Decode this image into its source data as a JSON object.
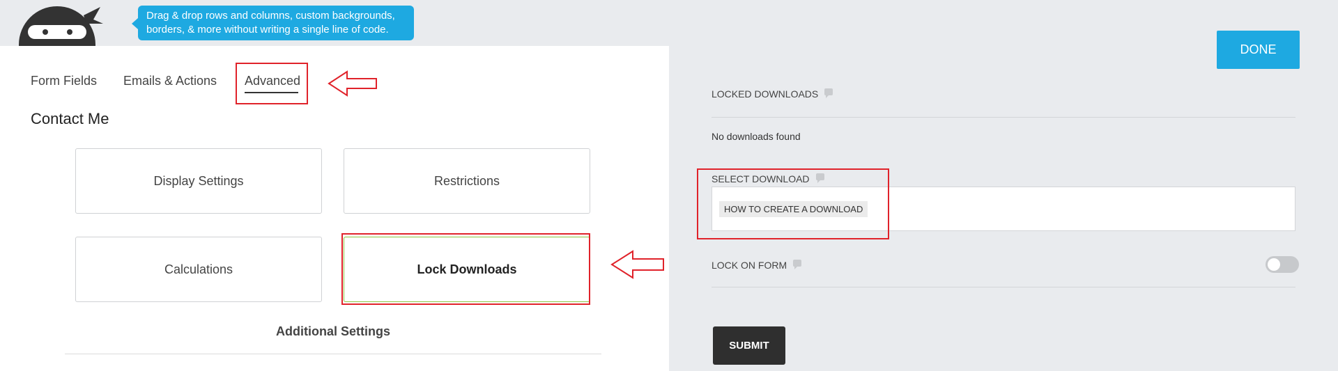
{
  "tooltip": {
    "line1": "Drag & drop rows and columns, custom backgrounds,",
    "line2": "borders, & more without writing a single line of code."
  },
  "tabs": {
    "form_fields": "Form Fields",
    "emails_actions": "Emails & Actions",
    "advanced": "Advanced"
  },
  "form_title": "Contact Me",
  "cards": {
    "display_settings": "Display Settings",
    "restrictions": "Restrictions",
    "calculations": "Calculations",
    "lock_downloads": "Lock Downloads"
  },
  "additional_settings": "Additional Settings",
  "settings": {
    "done_label": "DONE",
    "locked_downloads_label": "LOCKED DOWNLOADS",
    "no_downloads": "No downloads found",
    "select_download_label": "SELECT DOWNLOAD",
    "selected_download": "HOW TO CREATE A DOWNLOAD",
    "lock_on_form_label": "LOCK ON FORM",
    "lock_on_form_enabled": false,
    "submit_label": "SUBMIT"
  },
  "icons": {
    "logo": "ninja-logo-icon",
    "help": "comment-help-icon",
    "annotation": "left-arrow-icon"
  },
  "colors": {
    "accent": "#1ea9e1",
    "annotation_red": "#e0222a",
    "active_border": "#8bc43f",
    "submit_bg": "#2f2f2f",
    "panel_bg": "#e9ebee"
  }
}
